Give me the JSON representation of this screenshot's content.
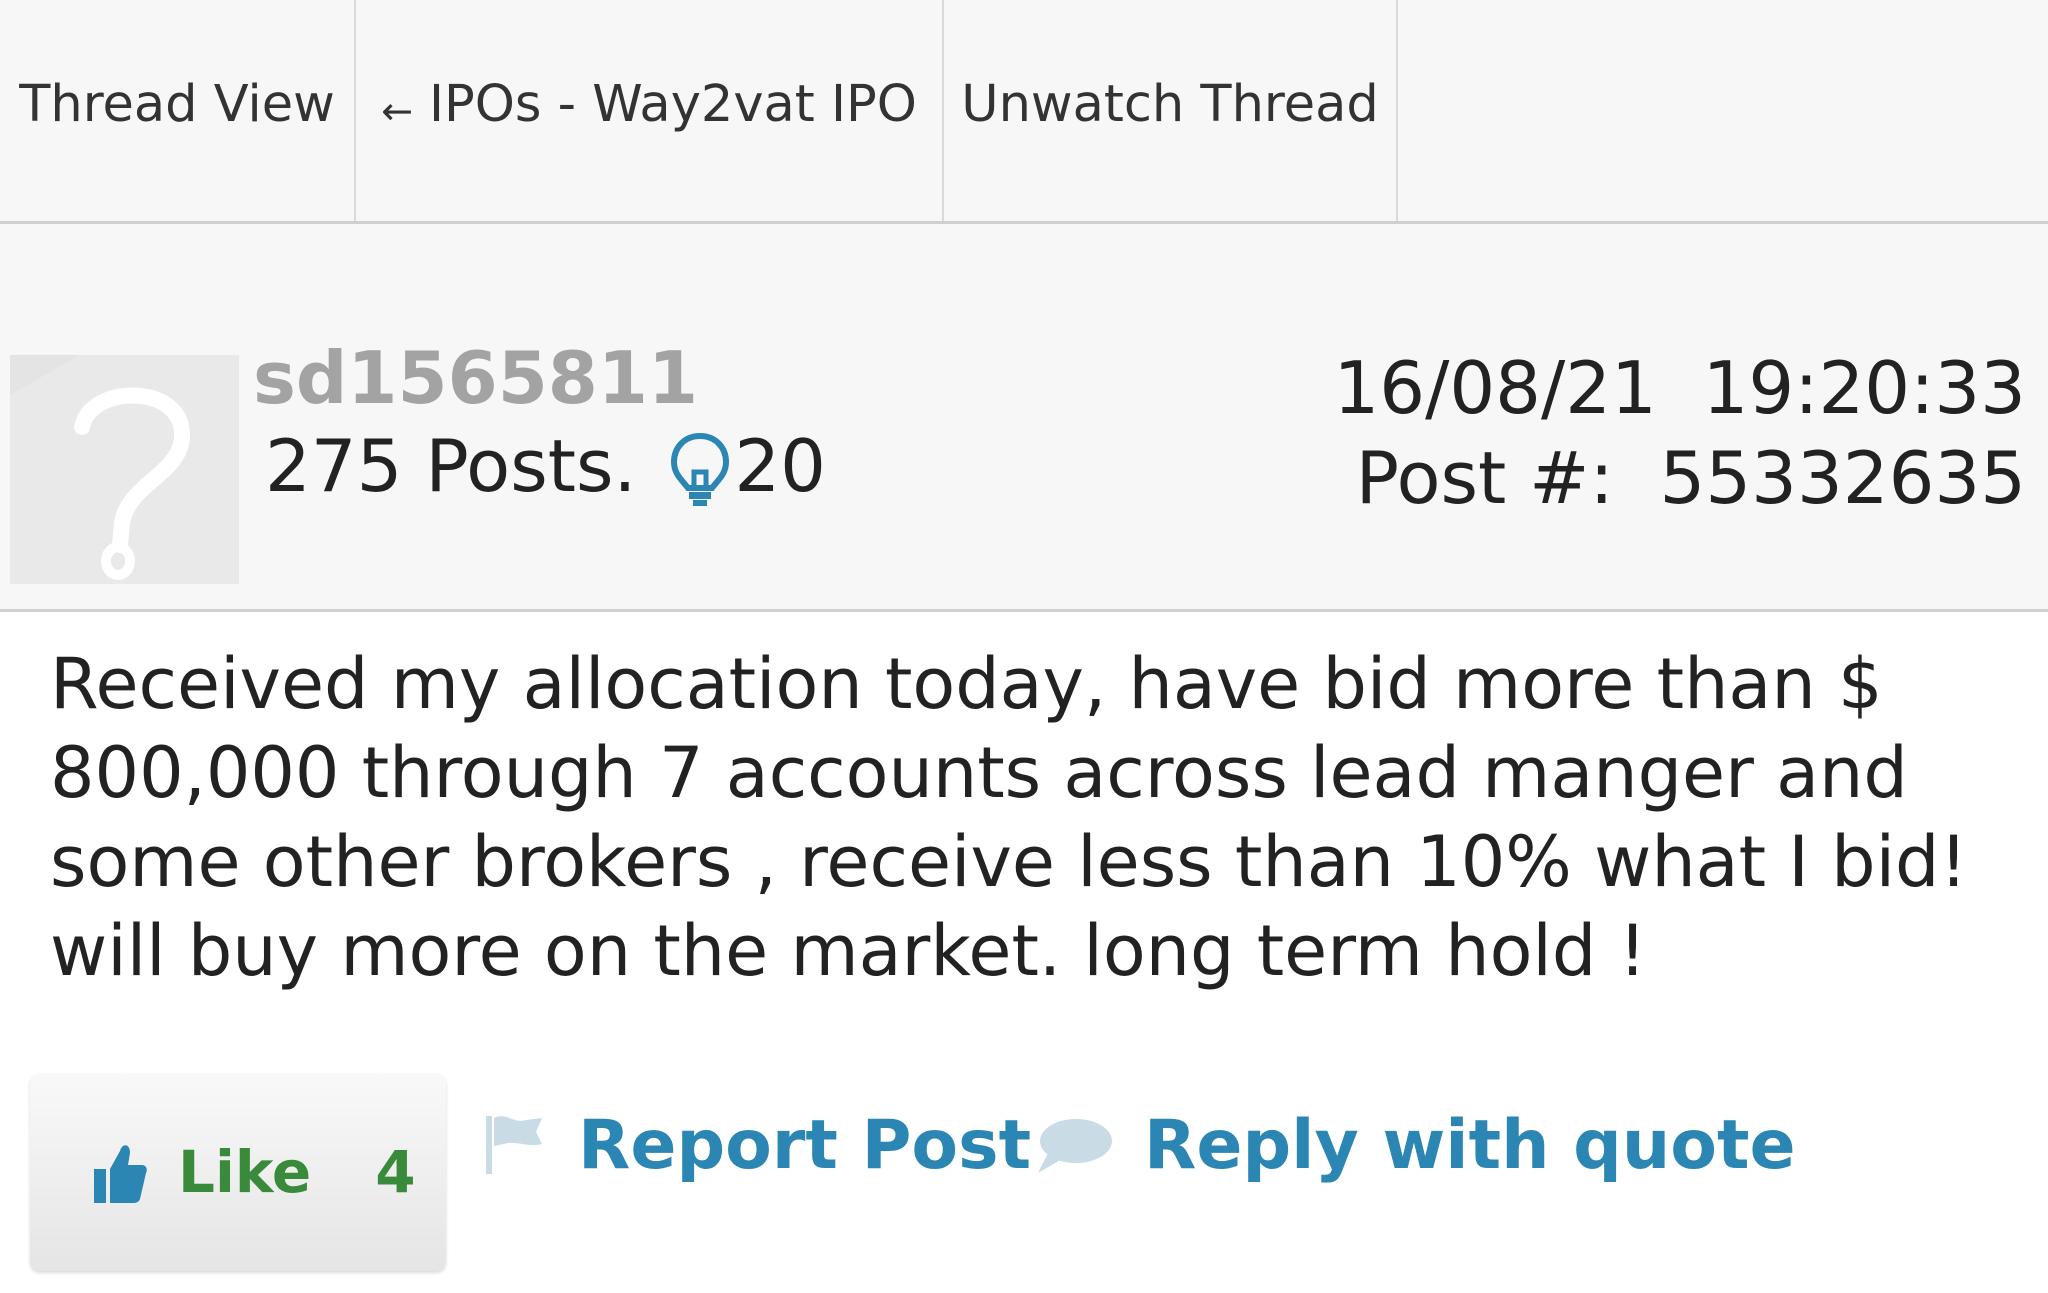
{
  "tabs": {
    "thread_view": "Thread View",
    "back_label": "IPOs - Way2vat IPO",
    "back_arrow": "←",
    "unwatch": "Unwatch Thread"
  },
  "post": {
    "username": "sd1565811",
    "posts": "275 Posts.",
    "lightbulbs": "20",
    "date_time": "16/08/21  19:20:33",
    "post_number": "Post #:  55332635",
    "body": "Received my allocation today, have bid more than $ 800,000 through 7 accounts across lead manger and some other brokers , receive less than 10% what I bid! will buy more on the market. long term hold !"
  },
  "actions": {
    "like_label": "Like",
    "like_count": "4",
    "report_label": "Report Post",
    "reply_label": "Reply with quote"
  },
  "icons": {
    "avatar": "default-avatar-question-mark",
    "lightbulb": "lightbulb-icon",
    "thumb": "thumbs-up-icon",
    "flag": "flag-icon",
    "bubble": "speech-bubble-icon"
  },
  "colors": {
    "link": "#2b86b4",
    "like": "#3a8a3c",
    "username": "#a3a3a3",
    "header_bg": "#f7f7f7"
  }
}
